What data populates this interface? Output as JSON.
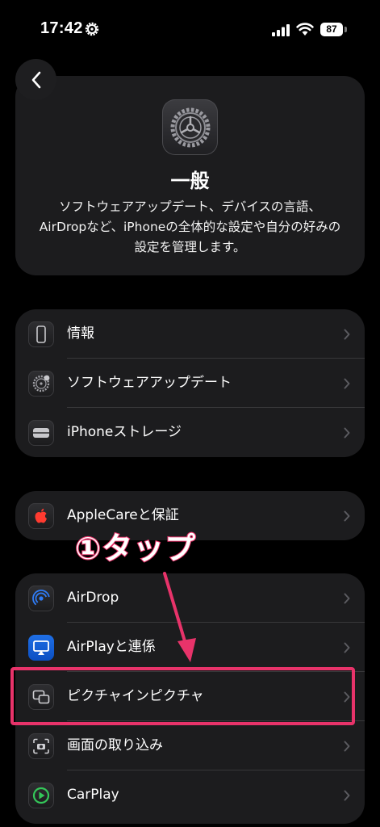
{
  "status_bar": {
    "time": "17:42",
    "battery": "87"
  },
  "header": {
    "title": "一般",
    "description": "ソフトウェアアップデート、デバイスの言語、AirDropなど、iPhoneの全体的な設定や自分の好みの設定を管理します。",
    "icon": "gear-icon"
  },
  "groups": [
    {
      "items": [
        {
          "label": "情報",
          "icon": "phone-icon"
        },
        {
          "label": "ソフトウェアアップデート",
          "icon": "gear-badge-icon"
        },
        {
          "label": "iPhoneストレージ",
          "icon": "storage-icon"
        }
      ]
    },
    {
      "items": [
        {
          "label": "AppleCareと保証",
          "icon": "apple-icon"
        }
      ]
    },
    {
      "items": [
        {
          "label": "AirDrop",
          "icon": "airdrop-icon"
        },
        {
          "label": "AirPlayと連係",
          "icon": "airplay-icon"
        },
        {
          "label": "ピクチャインピクチャ",
          "icon": "pip-icon"
        },
        {
          "label": "画面の取り込み",
          "icon": "screen-capture-icon"
        },
        {
          "label": "CarPlay",
          "icon": "carplay-icon"
        }
      ]
    }
  ],
  "annotation": {
    "text": "①タップ",
    "color": "#e8336a"
  }
}
